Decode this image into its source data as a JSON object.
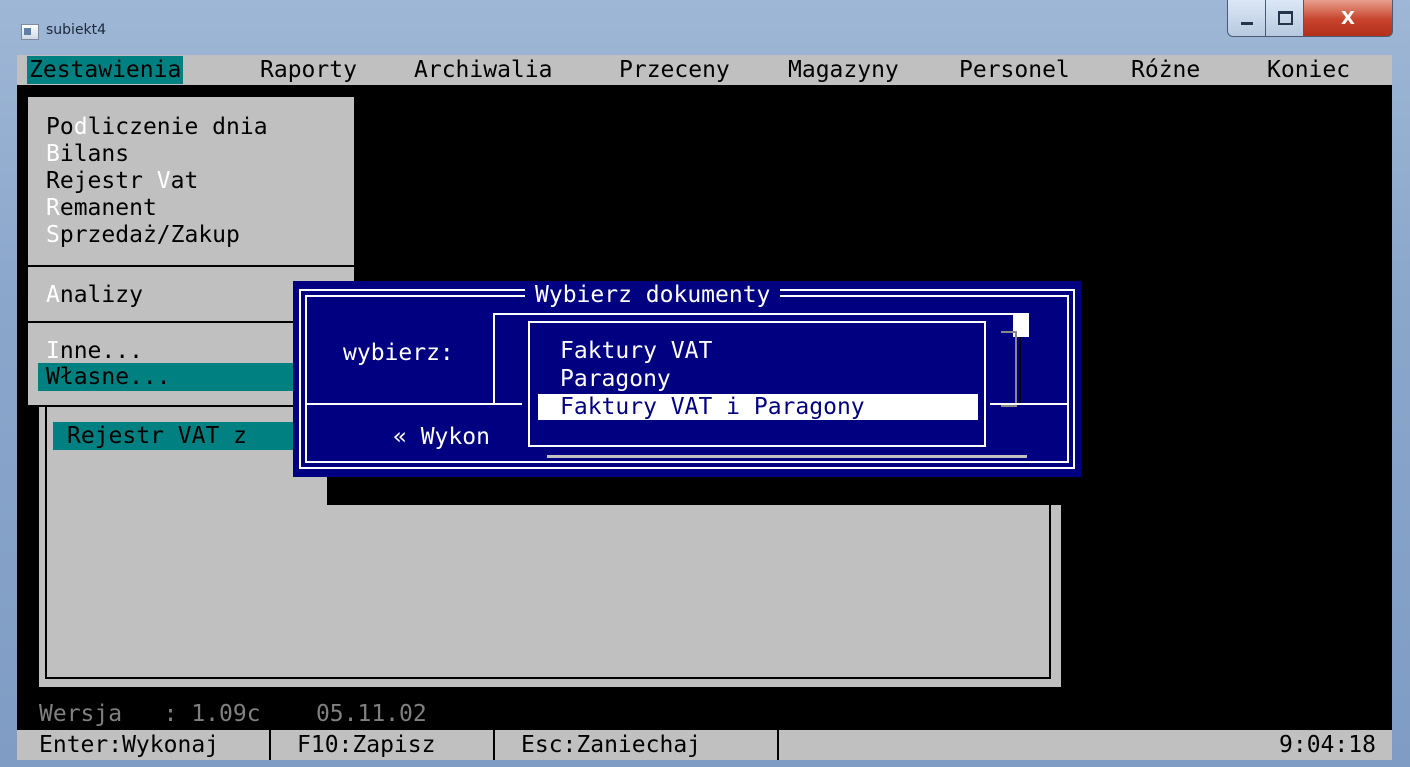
{
  "window": {
    "title": "subiekt4",
    "controls": {
      "minimize": "minimize",
      "maximize": "maximize",
      "close": "X"
    }
  },
  "menubar": {
    "items": [
      {
        "label": "Zestawienia",
        "selected": true
      },
      {
        "label": "Raporty"
      },
      {
        "label": "Archiwalia"
      },
      {
        "label": "Przeceny"
      },
      {
        "label": "Magazyny"
      },
      {
        "label": "Personel"
      },
      {
        "label": "Różne"
      },
      {
        "label": "Koniec"
      }
    ]
  },
  "dropdown": {
    "group1": [
      {
        "pre": "Po",
        "hk": "d",
        "post": "liczenie dnia"
      },
      {
        "pre": "",
        "hk": "B",
        "post": "ilans"
      },
      {
        "pre": "Rejestr ",
        "hk": "V",
        "post": "at"
      },
      {
        "pre": "",
        "hk": "R",
        "post": "emanent"
      },
      {
        "pre": "",
        "hk": "S",
        "post": "przedaż/Zakup"
      }
    ],
    "group2": [
      {
        "pre": "",
        "hk": "A",
        "post": "nalizy"
      }
    ],
    "group3": [
      {
        "pre": "",
        "hk": "I",
        "post": "nne..."
      },
      {
        "pre": "Własne...",
        "hk": "",
        "post": ""
      }
    ]
  },
  "subwindow": {
    "title": "Rejestr VAT z"
  },
  "dialog": {
    "title": "Wybierz dokumenty",
    "label": "wybierz:",
    "execute": "« Wykon"
  },
  "list": {
    "items": [
      "Faktury VAT",
      "Paragony",
      "Faktury VAT i Paragony"
    ],
    "selected_index": 2
  },
  "version": {
    "text": "Wersja   : 1.09c    05.11.02"
  },
  "status": {
    "enter": "Enter:Wykonaj",
    "f10": "F10:Zapisz",
    "esc": "Esc:Zaniechaj",
    "time": "9:04:18"
  },
  "colors": {
    "console_bg": "#000000",
    "panel_gray": "#c0c0c0",
    "highlight_teal": "#008080",
    "dialog_blue": "#000080"
  }
}
